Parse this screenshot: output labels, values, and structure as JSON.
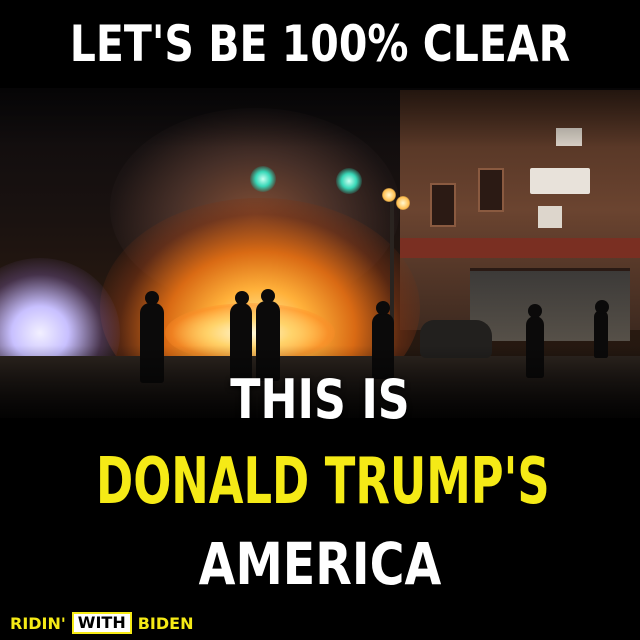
{
  "headline_top": "LET'S BE 100% CLEAR",
  "headline_line1": "THIS IS",
  "headline_line2": "DONALD TRUMP'S",
  "headline_line3": "AMERICA",
  "logo": {
    "part1": "RIDIN'",
    "part2": "WITH",
    "part3": "BIDEN"
  },
  "colors": {
    "background": "#000000",
    "accent_yellow": "#f5ea16",
    "text_white": "#ffffff"
  }
}
